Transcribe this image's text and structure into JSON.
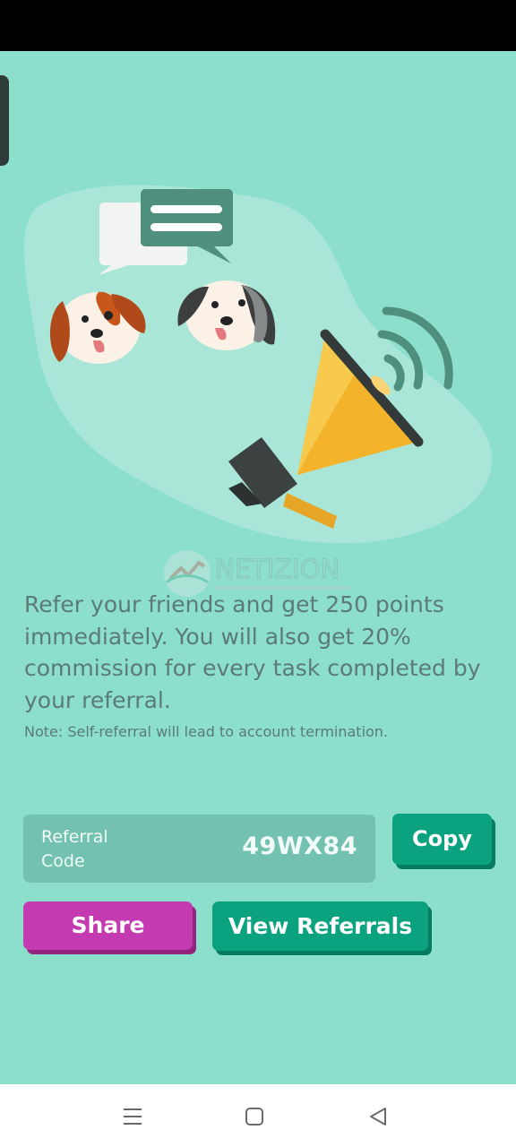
{
  "content": {
    "description": "Refer your friends and get 250 points immediately. You will also get 20% commission for every task completed by your referral.",
    "note": "Note: Self-referral will lead to account termination."
  },
  "referral": {
    "label": "Referral Code",
    "code": "49WX84",
    "copy_label": "Copy"
  },
  "actions": {
    "share_label": "Share",
    "view_referrals_label": "View Referrals"
  },
  "watermark": {
    "text": "NETIZION"
  },
  "colors": {
    "background": "#8cdfcb",
    "primary_button": "#0aa27f",
    "share_button": "#c33ab1",
    "text": "#5b7b74"
  },
  "icons": {
    "nav_menu": "menu-icon",
    "nav_home": "square-home-icon",
    "nav_back": "triangle-back-icon"
  }
}
